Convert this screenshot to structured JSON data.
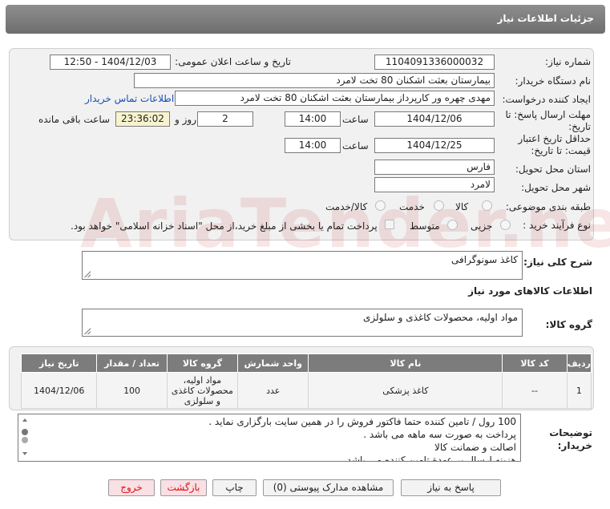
{
  "header": {
    "title": "جزئیات اطلاعات نیاز"
  },
  "fields": {
    "need_number_label": "شماره نیاز:",
    "need_number": "1104091336000032",
    "announce_label": "تاریخ و ساعت اعلان عمومی:",
    "announce_value": "1404/12/03 - 12:50",
    "buyer_org_label": "نام دستگاه خریدار:",
    "buyer_org": "بیمارستان بعثت اشکنان 80 تخت لامرد",
    "creator_label": "ایجاد کننده درخواست:",
    "creator": "مهدی چهره ور کارپرداز بیمارستان بعثت اشکنان 80 تخت لامرد",
    "contact_link": "اطلاعات تماس خریدار",
    "deadline_label": "مهلت ارسال پاسخ: تا تاریخ:",
    "deadline_date": "1404/12/06",
    "time_label": "ساعت",
    "deadline_time": "14:00",
    "days_value": "2",
    "days_label": "روز و",
    "remaining_time": "23:36:02",
    "remaining_label": "ساعت باقی مانده",
    "validity_label": "حداقل تاریخ اعتبار قیمت: تا تاریخ:",
    "validity_date": "1404/12/25",
    "validity_time": "14:00",
    "province_label": "استان محل تحویل:",
    "province": "فارس",
    "city_label": "شهر محل تحویل:",
    "city": "لامرد",
    "category_label": "طبقه بندی موضوعی:",
    "category_options": [
      "کالا",
      "خدمت",
      "کالا/خدمت"
    ],
    "process_label": "نوع فرآیند خرید :",
    "process_options": [
      "جزیی",
      "متوسط"
    ],
    "payment_text": "پرداخت تمام یا بخشی از مبلغ خرید،از محل \"اسناد خزانه اسلامی\" خواهد بود."
  },
  "summary": {
    "label": "شرح کلی نیاز:",
    "value": "کاغذ سونوگرافی"
  },
  "items_section": {
    "title": "اطلاعات کالاهای مورد نیاز",
    "group_label": "گروه کالا:",
    "group_value": "مواد اولیه، محصولات کاغذی و سلولزی"
  },
  "table": {
    "headers": [
      "ردیف",
      "کد کالا",
      "نام کالا",
      "واحد شمارش",
      "گروه کالا",
      "تعداد / مقدار",
      "تاریخ نیاز"
    ],
    "rows": [
      [
        "1",
        "--",
        "کاغذ پزشکی",
        "عدد",
        "مواد اولیه، محصولات کاغذی و سلولزی",
        "100",
        "1404/12/06"
      ]
    ]
  },
  "notes": {
    "label": "توضیحات خریدار:",
    "lines": [
      "100 رول / تامین کننده حتما فاکتور فروش را در همین سایت بارگزاری نماید .",
      "پرداخت به صورت سه ماهه می باشد .",
      "اصالت و ضمانت کالا",
      "هزینه ارسال بر عهدة تامین کننده می باشد ."
    ]
  },
  "buttons": {
    "reply": "پاسخ به نیاز",
    "attachments": "مشاهده مدارک پیوستی (0)",
    "print": "چاپ",
    "back": "بازگشت",
    "exit": "خروج"
  },
  "watermark": "AriaTender.net",
  "colors": {
    "header_bg": "#7c7c7c",
    "link": "#1a4fb4",
    "highlight": "#f8f3cf",
    "exit_text": "#dd1111"
  }
}
